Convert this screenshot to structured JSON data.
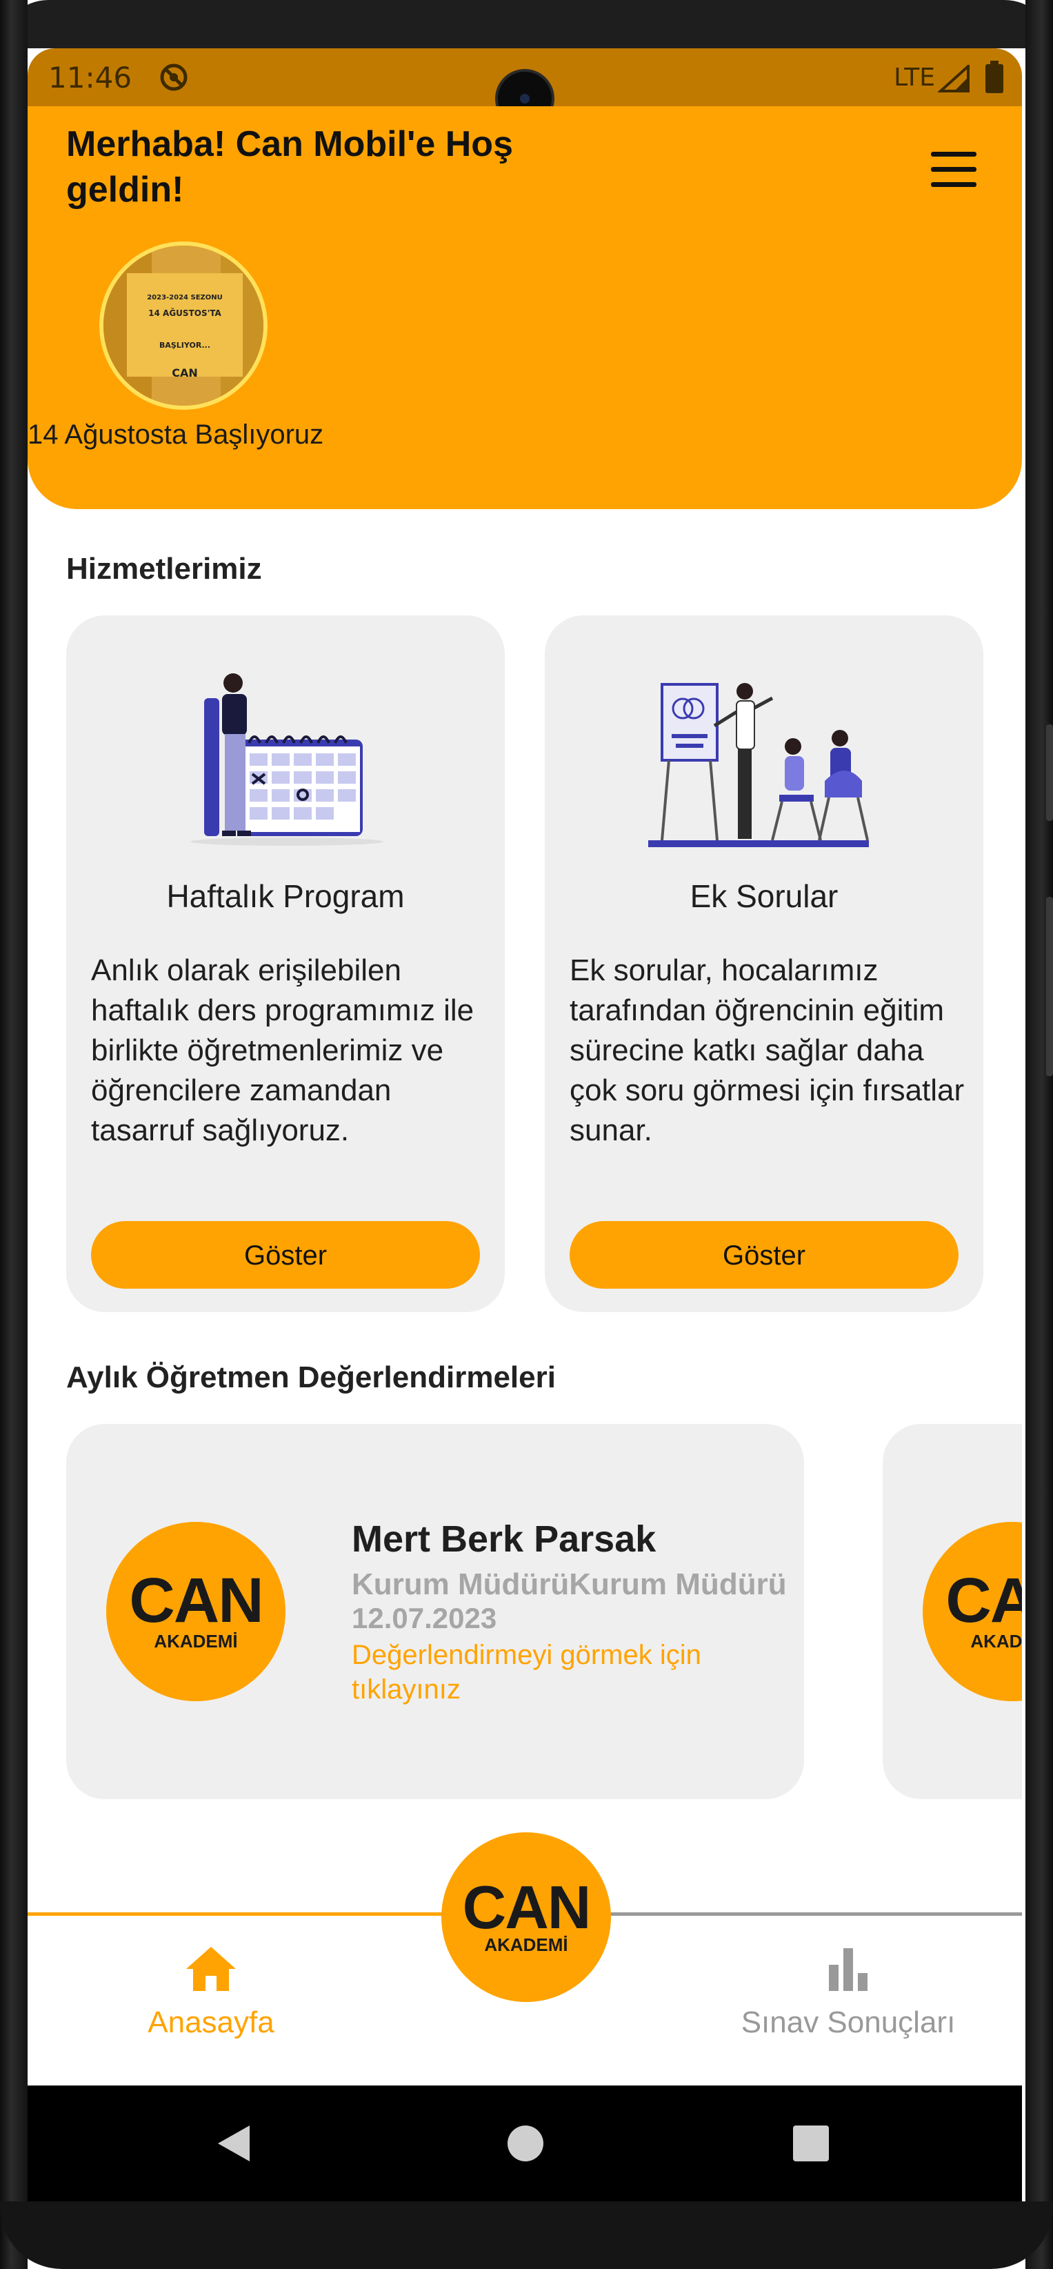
{
  "status_bar": {
    "time": "11:46",
    "network": "LTE"
  },
  "header": {
    "greeting": "Merhaba! Can Mobil'e Hoş geldin!",
    "story": {
      "label": "14 Ağustosta Başlıyoruz",
      "image_lines": [
        "2023-2024 SEZONU",
        "14 AĞUSTOS'TA",
        "BAŞLIYOR...",
        "CAN"
      ]
    }
  },
  "services": {
    "title": "Hizmetlerimiz",
    "items": [
      {
        "title": "Haftalık Program",
        "description": "Anlık olarak erişilebilen haftalık ders programımız ile birlikte öğretmenlerimiz ve öğrencilere zamandan tasarruf sağlıyoruz.",
        "button": "Göster"
      },
      {
        "title": "Ek Sorular",
        "description": "Ek sorular, hocalarımız tarafından öğrencinin eğitim sürecine katkı sağlar daha çok soru görmesi için fırsatlar sunar.",
        "button": "Göster"
      }
    ]
  },
  "evaluations": {
    "title": "Aylık Öğretmen Değerlendirmeleri",
    "items": [
      {
        "name": "Mert Berk Parsak",
        "role": "Kurum MüdürüKurum Müdürü",
        "date": "12.07.2023",
        "link": "Değerlendirmeyi görmek için tıklayınız",
        "logo": {
          "brand": "CAN",
          "sub": "AKADEMİ"
        }
      }
    ]
  },
  "bottom_nav": {
    "items": [
      {
        "label": "Anasayfa",
        "icon": "home-icon",
        "active": true
      },
      {
        "label": "Sınav Sonuçları",
        "icon": "bar-chart-icon",
        "active": false
      }
    ],
    "center_logo": {
      "brand": "CAN",
      "sub": "AKADEMİ"
    }
  },
  "colors": {
    "primary": "#ffa302",
    "status_bar": "#c17a00",
    "card_bg": "#efefef",
    "inactive": "#999999"
  }
}
